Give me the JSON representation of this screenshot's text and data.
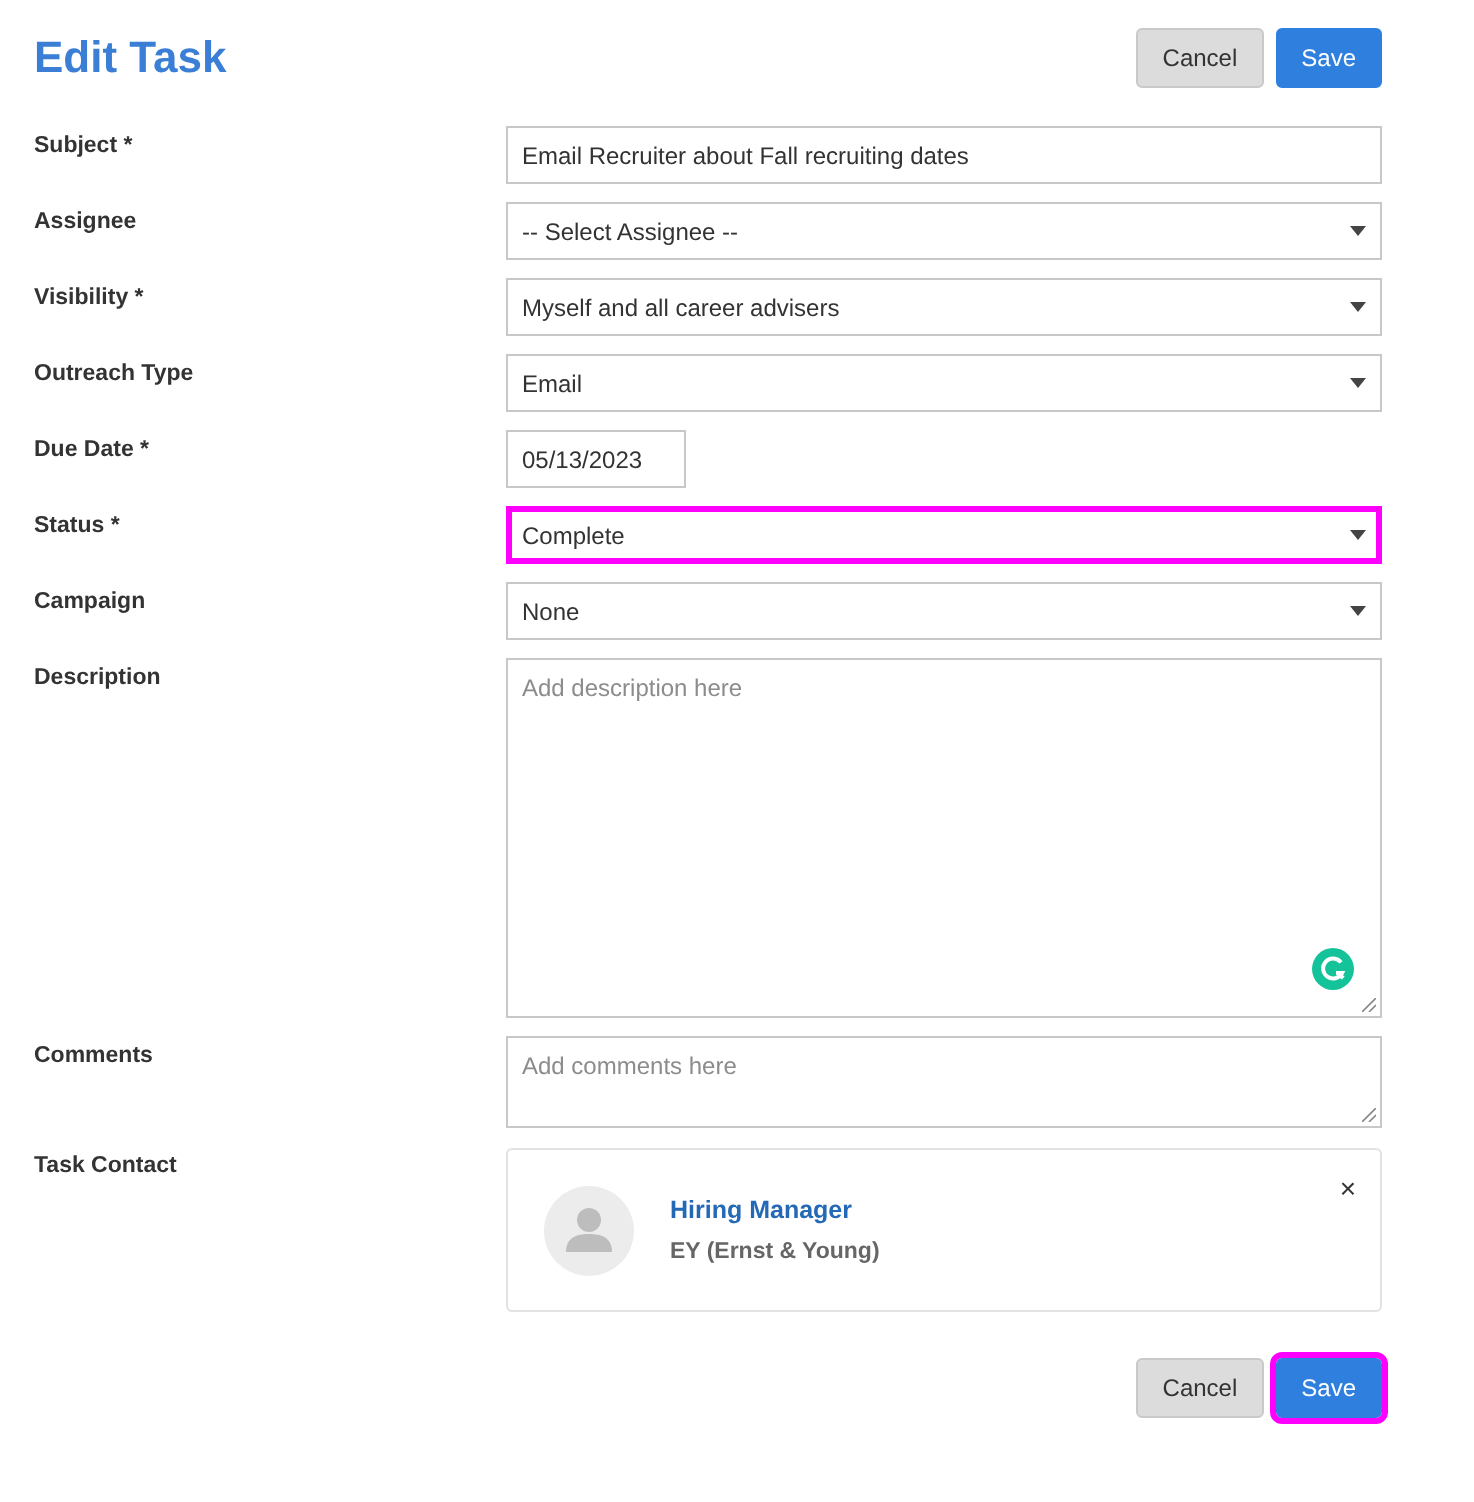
{
  "page": {
    "title": "Edit Task"
  },
  "top_buttons": [
    {
      "label": "Cancel",
      "kind": "secondary",
      "highlighted": false
    },
    {
      "label": "Save",
      "kind": "primary",
      "highlighted": false
    }
  ],
  "fields": [
    {
      "label": "Subject *",
      "kind": "text",
      "value": "Email Recruiter about Fall recruiting dates",
      "highlighted": false
    },
    {
      "label": "Assignee",
      "kind": "select",
      "value": "-- Select Assignee --",
      "highlighted": false
    },
    {
      "label": "Visibility *",
      "kind": "select",
      "value": "Myself and all career advisers",
      "highlighted": false
    },
    {
      "label": "Outreach Type",
      "kind": "select",
      "value": "Email",
      "highlighted": false
    },
    {
      "label": "Due Date *",
      "kind": "date",
      "value": "05/13/2023",
      "highlighted": false
    },
    {
      "label": "Status *",
      "kind": "select",
      "value": "Complete",
      "highlighted": true
    },
    {
      "label": "Campaign",
      "kind": "select",
      "value": "None",
      "highlighted": false
    },
    {
      "label": "Description",
      "kind": "tall_textarea",
      "placeholder": "Add description here",
      "highlighted": false
    },
    {
      "label": "Comments",
      "kind": "short_textarea",
      "placeholder": "Add comments here",
      "highlighted": false
    },
    {
      "label": "Task Contact",
      "kind": "contact",
      "name": "Hiring Manager",
      "company": "EY (Ernst & Young)",
      "remove": "×",
      "highlighted": false
    }
  ],
  "bottom_buttons": [
    {
      "label": "Cancel",
      "kind": "secondary",
      "highlighted": false
    },
    {
      "label": "Save",
      "kind": "primary",
      "highlighted": true
    }
  ]
}
